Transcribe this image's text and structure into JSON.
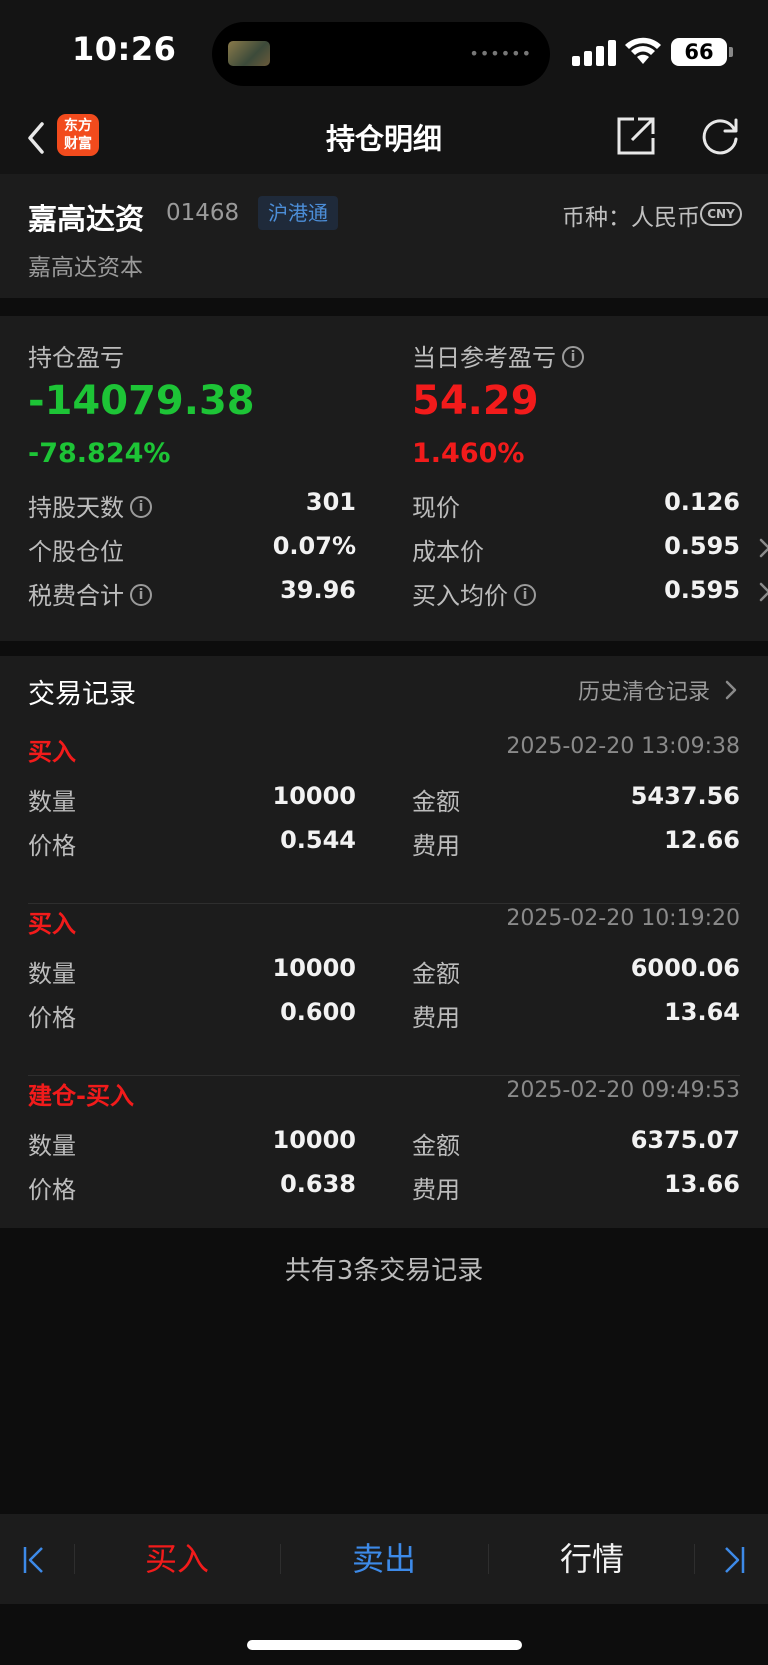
{
  "status_bar": {
    "time": "10:26",
    "battery": "66",
    "island_dots": "••••••"
  },
  "nav": {
    "title": "持仓明细",
    "logo_line1": "东方",
    "logo_line2": "财富"
  },
  "stock": {
    "name": "嘉高达资",
    "code": "01468",
    "tag": "沪港通",
    "currency_label": "币种：人民币",
    "currency_badge": "CNY",
    "full_name": "嘉高达资本"
  },
  "pnl": {
    "holding_label": "持仓盈亏",
    "holding_value": "-14079.38",
    "holding_pct": "-78.824%",
    "daily_label": "当日参考盈亏",
    "daily_value": "54.29",
    "daily_pct": "1.460%",
    "left_rows": [
      {
        "label": "持股天数",
        "value": "301",
        "info": true
      },
      {
        "label": "个股仓位",
        "value": "0.07%",
        "info": false
      },
      {
        "label": "税费合计",
        "value": "39.96",
        "info": true
      }
    ],
    "right_rows": [
      {
        "label": "现价",
        "value": "0.126",
        "info": false,
        "chevron": false
      },
      {
        "label": "成本价",
        "value": "0.595",
        "info": false,
        "chevron": true
      },
      {
        "label": "买入均价",
        "value": "0.595",
        "info": true,
        "chevron": true
      }
    ]
  },
  "trades": {
    "title": "交易记录",
    "history_link": "历史清仓记录",
    "labels": {
      "qty": "数量",
      "amount": "金额",
      "price": "价格",
      "fee": "费用"
    },
    "items": [
      {
        "type": "买入",
        "time": "2025-02-20 13:09:38",
        "qty": "10000",
        "amount": "5437.56",
        "price": "0.544",
        "fee": "12.66"
      },
      {
        "type": "买入",
        "time": "2025-02-20 10:19:20",
        "qty": "10000",
        "amount": "6000.06",
        "price": "0.600",
        "fee": "13.64"
      },
      {
        "type": "建仓-买入",
        "time": "2025-02-20 09:49:53",
        "qty": "10000",
        "amount": "6375.07",
        "price": "0.638",
        "fee": "13.66"
      }
    ],
    "footer": "共有3条交易记录"
  },
  "toolbar": {
    "buy": "买入",
    "sell": "卖出",
    "market": "行情"
  },
  "colors": {
    "up": "#f21b1b",
    "down": "#1dc436",
    "link": "#3d8ae8",
    "background": "#0d0d0d",
    "card": "#1c1c1c"
  }
}
